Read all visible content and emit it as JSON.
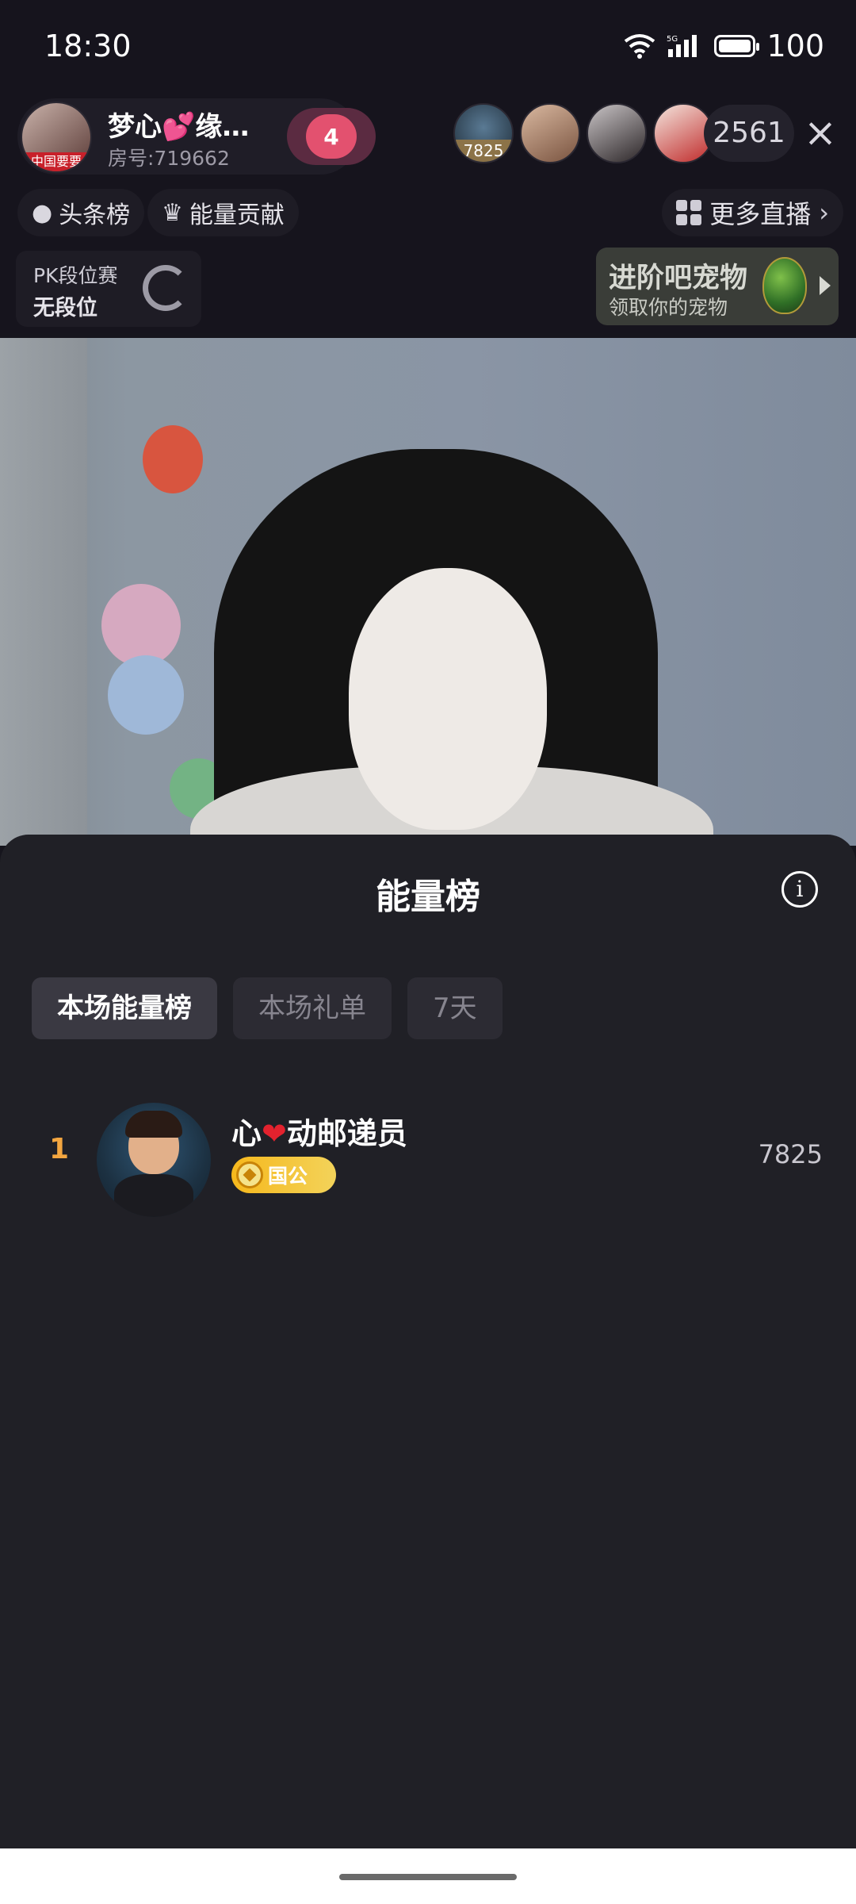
{
  "status_bar": {
    "time": "18:30",
    "battery": "100",
    "network": "5G"
  },
  "host": {
    "name": "梦心💕缘…",
    "room_no": "房号:719662",
    "avatar_tag": "中国要要",
    "fans_level": "4"
  },
  "viewers": {
    "top_score": "7825",
    "count": "2561"
  },
  "chips": {
    "headline": "头条榜",
    "energy_contrib": "能量贡献",
    "more_live": "更多直播"
  },
  "pk": {
    "title": "PK段位赛",
    "rank": "无段位"
  },
  "pet_banner": {
    "title": "进阶吧宠物",
    "subtitle": "领取你的宠物"
  },
  "sheet": {
    "title": "能量榜",
    "tabs": [
      {
        "label": "本场能量榜",
        "active": true
      },
      {
        "label": "本场礼单",
        "active": false
      },
      {
        "label": "7天",
        "active": false
      }
    ],
    "rows": [
      {
        "rank": "1",
        "name_prefix": "心",
        "name_suffix": "动邮递员",
        "heart": "❤",
        "badge": "国公",
        "score": "7825"
      }
    ]
  },
  "colors": {
    "rank_gold": "#f3a640",
    "badge_gold": "#f6b81c",
    "sheet_bg": "#202026"
  }
}
